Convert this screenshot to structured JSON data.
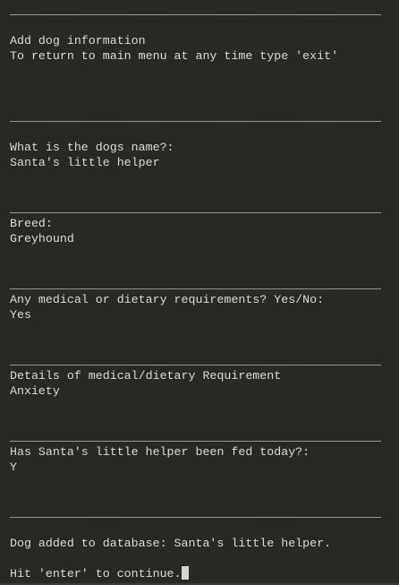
{
  "terminal": {
    "lines": [
      "____________________________________________________",
      "",
      "Add dog information",
      "To return to main menu at any time type 'exit'",
      "",
      "",
      "",
      "____________________________________________________",
      "",
      "What is the dogs name?:",
      "Santa's little helper",
      "",
      "",
      "____________________________________________________",
      "Breed:",
      "Greyhound",
      "",
      "",
      "____________________________________________________",
      "Any medical or dietary requirements? Yes/No:",
      "Yes",
      "",
      "",
      "____________________________________________________",
      "Details of medical/dietary Requirement",
      "Anxiety",
      "",
      "",
      "____________________________________________________",
      "Has Santa's little helper been fed today?:",
      "Y",
      "",
      "",
      "____________________________________________________",
      "",
      "Dog added to database: Santa's little helper.",
      "",
      "Hit 'enter' to continue."
    ]
  }
}
